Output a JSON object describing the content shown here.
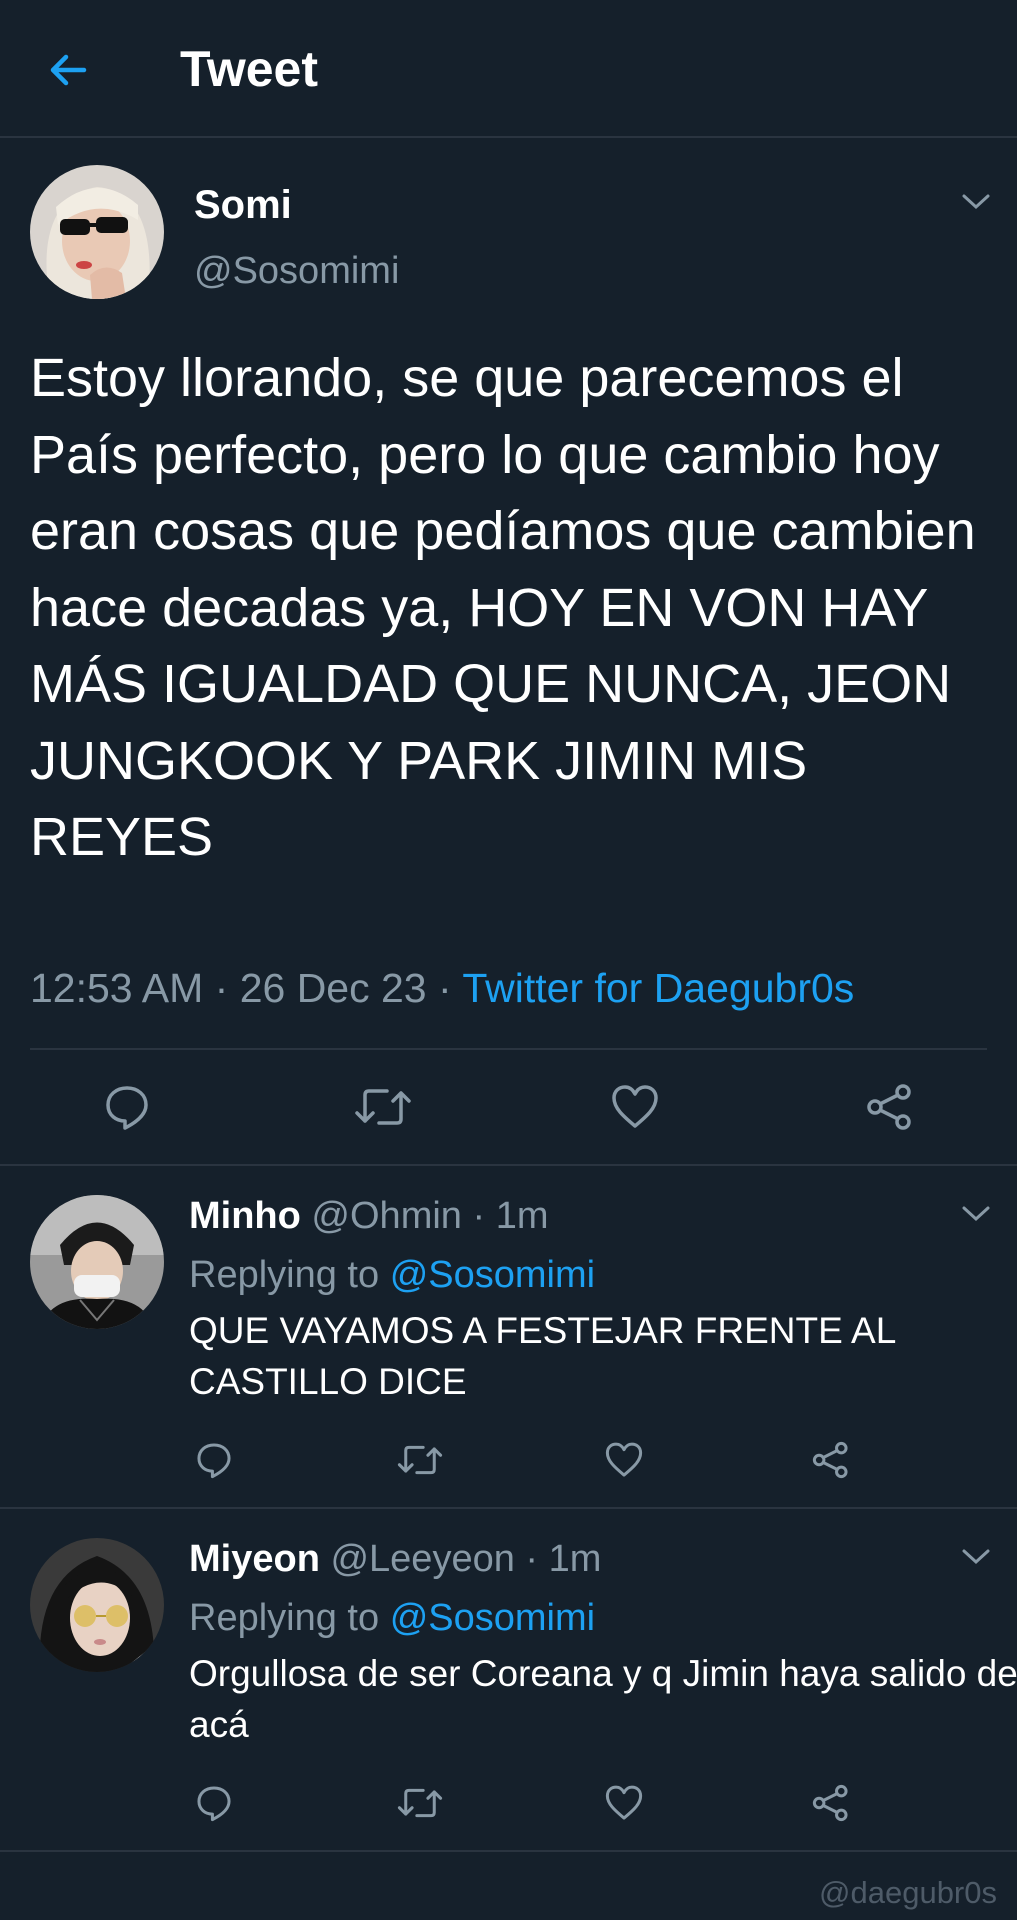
{
  "header": {
    "title": "Tweet",
    "back_icon": "back-arrow-icon",
    "accent": "#1da1f2"
  },
  "tweet": {
    "name": "Somi",
    "handle": "@Sosomimi",
    "text": "Estoy llorando, se que parecemos el País perfecto, pero lo que cambio hoy eran cosas que pedíamos que cambien hace decadas ya, HOY EN VON HAY MÁS IGUALDAD QUE NUNCA, JEON JUNGKOOK Y PARK JIMIN MIS REYES",
    "time": "12:53 AM",
    "date": "26 Dec 23",
    "source": "Twitter for Daegubr0s",
    "separator": "·",
    "actions": [
      "reply-icon",
      "retweet-icon",
      "like-icon",
      "share-icon"
    ]
  },
  "replies": [
    {
      "name": "Minho",
      "handle": "@Ohmin",
      "time": "1m",
      "replying_prefix": "Replying to",
      "replying_to": "@Sosomimi",
      "text": "QUE VAYAMOS A FESTEJAR FRENTE AL CASTILLO DICE"
    },
    {
      "name": "Miyeon",
      "handle": "@Leeyeon",
      "time": "1m",
      "replying_prefix": "Replying to",
      "replying_to": "@Sosomimi",
      "text": "Orgullosa de ser Coreana y q Jimin haya salido de acá"
    }
  ],
  "watermark": "@daegubr0s",
  "colors": {
    "background": "#15202b",
    "secondary_text": "#8899a6",
    "link": "#1da1f2",
    "divider": "#2a3440"
  }
}
